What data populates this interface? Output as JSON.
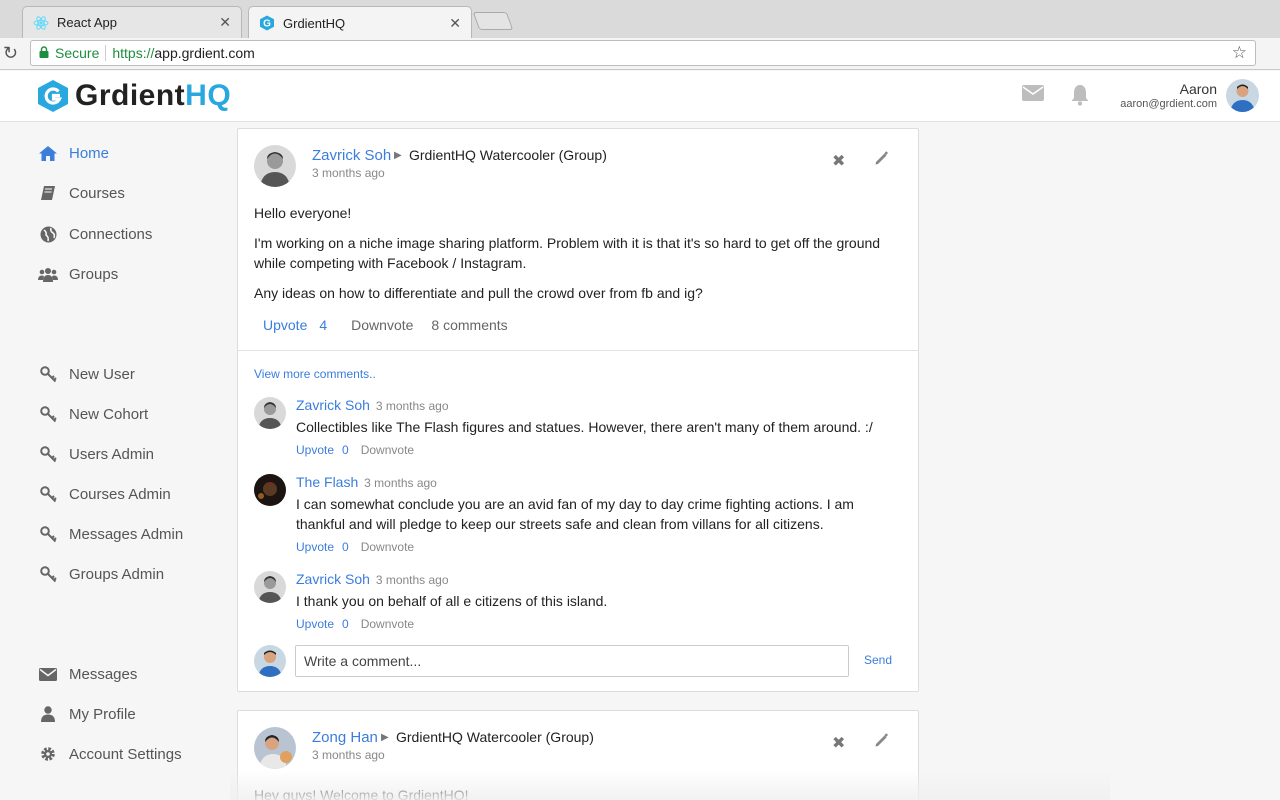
{
  "browser": {
    "tabs": [
      {
        "label": "React App",
        "icon": "react-icon"
      },
      {
        "label": "GrdientHQ",
        "icon": "grdient-favicon"
      }
    ],
    "secure_label": "Secure",
    "url_scheme": "https://",
    "url_host": "app.grdient.com"
  },
  "header": {
    "logo_main": "Grdient",
    "logo_accent": "HQ",
    "user_name": "Aaron",
    "user_email": "aaron@grdient.com"
  },
  "sidebar": {
    "main": [
      {
        "label": "Home",
        "icon": "home-icon",
        "active": true
      },
      {
        "label": "Courses",
        "icon": "book-icon"
      },
      {
        "label": "Connections",
        "icon": "globe-icon"
      },
      {
        "label": "Groups",
        "icon": "users-icon"
      }
    ],
    "admin": [
      {
        "label": "New User",
        "icon": "key-icon"
      },
      {
        "label": "New Cohort",
        "icon": "key-icon"
      },
      {
        "label": "Users Admin",
        "icon": "key-icon"
      },
      {
        "label": "Courses Admin",
        "icon": "key-icon"
      },
      {
        "label": "Messages Admin",
        "icon": "key-icon"
      },
      {
        "label": "Groups Admin",
        "icon": "key-icon"
      }
    ],
    "account": [
      {
        "label": "Messages",
        "icon": "envelope-icon"
      },
      {
        "label": "My Profile",
        "icon": "user-icon"
      },
      {
        "label": "Account Settings",
        "icon": "gear-icon"
      }
    ]
  },
  "posts": [
    {
      "author": "Zavrick Soh",
      "group": "GrdientHQ Watercooler (Group)",
      "time": "3 months ago",
      "paragraphs": [
        "Hello everyone!",
        "I'm working on a niche image sharing platform. Problem with it is that it's so hard to get off the ground while competing with Facebook / Instagram.",
        "Any ideas on how to differentiate and pull the crowd over from fb and ig?"
      ],
      "upvote_label": "Upvote",
      "upvotes": "4",
      "downvote_label": "Downvote",
      "comments_label": "8 comments",
      "view_more": "View more comments..",
      "comments": [
        {
          "author": "Zavrick Soh",
          "time": "3 months ago",
          "text": "Collectibles like The Flash figures and statues. However, there aren't many of them around. :/",
          "upvote_label": "Upvote",
          "upvotes": "0",
          "downvote_label": "Downvote"
        },
        {
          "author": "The Flash",
          "time": "3 months ago",
          "text": "I can somewhat conclude you are an avid fan of my day to day crime fighting actions. I am thankful and will pledge to keep our streets safe and clean from villans for all citizens.",
          "upvote_label": "Upvote",
          "upvotes": "0",
          "downvote_label": "Downvote"
        },
        {
          "author": "Zavrick Soh",
          "time": "3 months ago",
          "text": "I thank you on behalf of all e citizens of this island.",
          "upvote_label": "Upvote",
          "upvotes": "0",
          "downvote_label": "Downvote"
        }
      ],
      "reply_placeholder": "Write a comment...",
      "send_label": "Send"
    },
    {
      "author": "Zong Han",
      "group": "GrdientHQ Watercooler (Group)",
      "time": "3 months ago",
      "paragraphs": [
        "Hey guys! Welcome to GrdientHQ!"
      ]
    }
  ],
  "colors": {
    "accent": "#3b7ddd",
    "brand": "#29a8e0",
    "secure": "#1e8e3e"
  }
}
